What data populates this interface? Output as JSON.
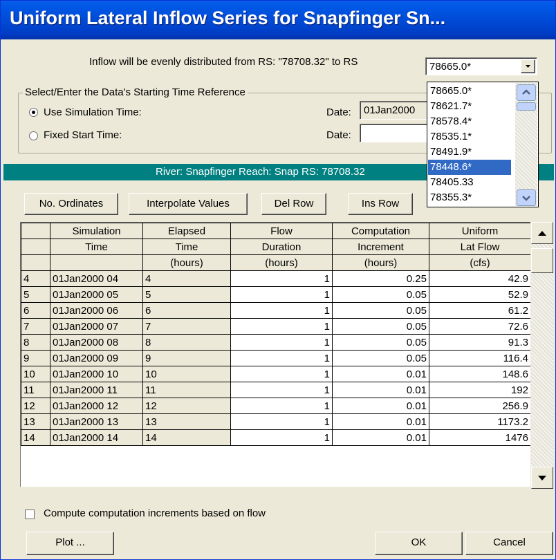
{
  "window": {
    "title": "Uniform Lateral Inflow Series for Snapfinger Sn..."
  },
  "inflow": {
    "text": "Inflow will be evenly distributed from RS: \"78708.32\"  to RS",
    "to_rs_selected": "78665.0*",
    "options": [
      "78665.0*",
      "78621.7*",
      "78578.4*",
      "78535.1*",
      "78491.9*",
      "78448.6*",
      "78405.33",
      "78355.3*"
    ],
    "highlighted": "78448.6*"
  },
  "time_ref": {
    "group_label": "Select/Enter the Data's Starting Time Reference",
    "use_sim_label": "Use Simulation Time:",
    "fixed_label": "Fixed Start Time:",
    "date_label_1": "Date:",
    "date_value_1": "01Jan2000",
    "date_label_2": "Date:",
    "date_value_2": "",
    "selected": "use_sim"
  },
  "banner": {
    "text": "River: Snapfinger  Reach: Snap  RS: 78708.32"
  },
  "toolbar": {
    "no_ordinates": "No. Ordinates",
    "interpolate": "Interpolate Values",
    "del_row": "Del Row",
    "ins_row": "Ins Row"
  },
  "table": {
    "header_rows": [
      [
        "Simulation",
        "Elapsed",
        "Flow",
        "Computation",
        "Uniform"
      ],
      [
        "Time",
        "Time",
        "Duration",
        "Increment",
        "Lat Flow"
      ],
      [
        "",
        "(hours)",
        "(hours)",
        "(hours)",
        "(cfs)"
      ]
    ],
    "rows": [
      {
        "n": "4",
        "sim": "01Jan2000 04",
        "elapsed": "4",
        "duration": "1",
        "increment": "0.25",
        "flow": "42.9"
      },
      {
        "n": "5",
        "sim": "01Jan2000 05",
        "elapsed": "5",
        "duration": "1",
        "increment": "0.05",
        "flow": "52.9"
      },
      {
        "n": "6",
        "sim": "01Jan2000 06",
        "elapsed": "6",
        "duration": "1",
        "increment": "0.05",
        "flow": "61.2"
      },
      {
        "n": "7",
        "sim": "01Jan2000 07",
        "elapsed": "7",
        "duration": "1",
        "increment": "0.05",
        "flow": "72.6"
      },
      {
        "n": "8",
        "sim": "01Jan2000 08",
        "elapsed": "8",
        "duration": "1",
        "increment": "0.05",
        "flow": "91.3"
      },
      {
        "n": "9",
        "sim": "01Jan2000 09",
        "elapsed": "9",
        "duration": "1",
        "increment": "0.05",
        "flow": "116.4"
      },
      {
        "n": "10",
        "sim": "01Jan2000 10",
        "elapsed": "10",
        "duration": "1",
        "increment": "0.01",
        "flow": "148.6"
      },
      {
        "n": "11",
        "sim": "01Jan2000 11",
        "elapsed": "11",
        "duration": "1",
        "increment": "0.01",
        "flow": "192"
      },
      {
        "n": "12",
        "sim": "01Jan2000 12",
        "elapsed": "12",
        "duration": "1",
        "increment": "0.01",
        "flow": "256.9"
      },
      {
        "n": "13",
        "sim": "01Jan2000 13",
        "elapsed": "13",
        "duration": "1",
        "increment": "0.01",
        "flow": "1173.2"
      },
      {
        "n": "14",
        "sim": "01Jan2000 14",
        "elapsed": "14",
        "duration": "1",
        "increment": "0.01",
        "flow": "1476"
      }
    ]
  },
  "footer": {
    "compute_label": "Compute computation increments based on flow",
    "plot": "Plot ...",
    "ok": "OK",
    "cancel": "Cancel"
  }
}
